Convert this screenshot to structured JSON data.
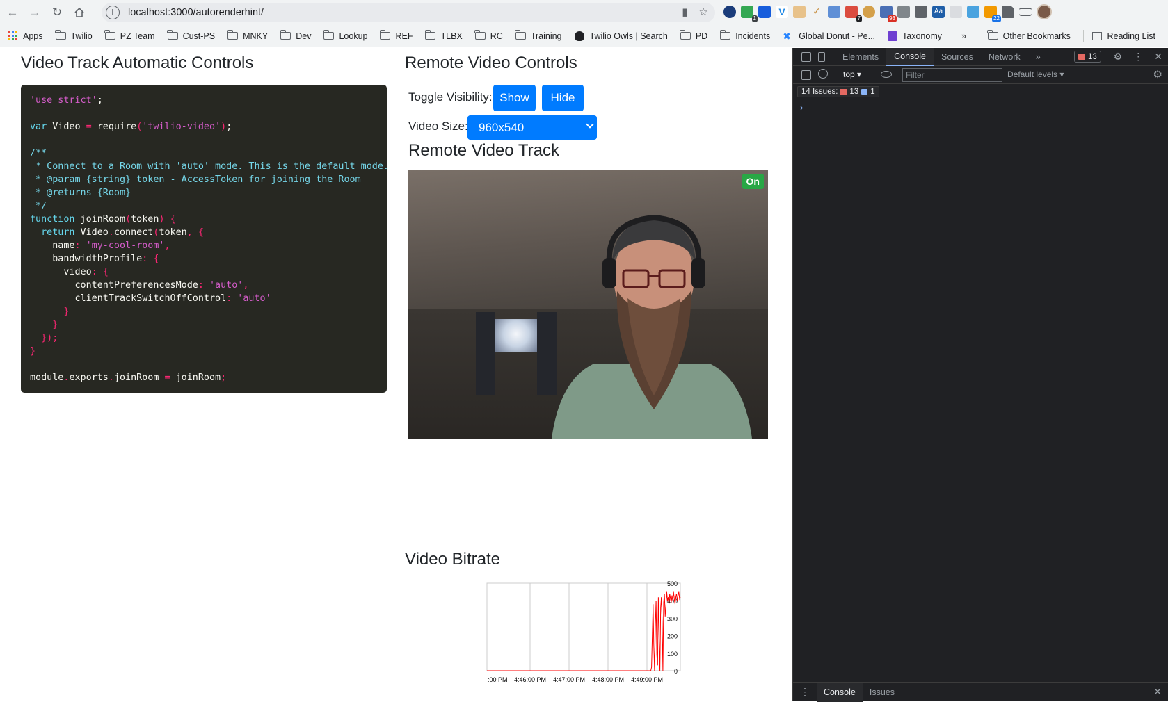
{
  "browser": {
    "url": "localhost:3000/autorenderhint/",
    "bookmarks": [
      {
        "label": "Apps",
        "type": "apps"
      },
      {
        "label": "Twilio",
        "type": "folder"
      },
      {
        "label": "PZ Team",
        "type": "folder"
      },
      {
        "label": "Cust-PS",
        "type": "folder"
      },
      {
        "label": "MNKY",
        "type": "folder"
      },
      {
        "label": "Dev",
        "type": "folder"
      },
      {
        "label": "Lookup",
        "type": "folder"
      },
      {
        "label": "REF",
        "type": "folder"
      },
      {
        "label": "TLBX",
        "type": "folder"
      },
      {
        "label": "RC",
        "type": "folder"
      },
      {
        "label": "Training",
        "type": "folder"
      },
      {
        "label": "Twilio Owls | Search",
        "type": "owl"
      },
      {
        "label": "PD",
        "type": "folder"
      },
      {
        "label": "Incidents",
        "type": "folder"
      },
      {
        "label": "Global Donut - Pe...",
        "type": "atlassian"
      },
      {
        "label": "Taxonomy",
        "type": "taxonomy"
      }
    ],
    "overflow": "»",
    "other_bookmarks": "Other Bookmarks",
    "reading_list": "Reading List",
    "ext_badges": {
      "b1": "1",
      "b7": "7",
      "b93": "93",
      "b22": "22"
    }
  },
  "left": {
    "title": "Video Track Automatic Controls",
    "code_lines": [
      [
        [
          "c-pink",
          "'use strict'"
        ],
        [
          "",
          "; "
        ]
      ],
      [],
      [
        [
          "c-kw",
          "var"
        ],
        [
          "",
          " Video "
        ],
        [
          "c-red",
          "="
        ],
        [
          "",
          " require"
        ],
        [
          "c-red",
          "("
        ],
        [
          "c-pink",
          "'twilio-video'"
        ],
        [
          "c-red",
          ")"
        ],
        [
          "",
          ";"
        ]
      ],
      [],
      [
        [
          "c-com",
          "/**"
        ]
      ],
      [
        [
          "c-com",
          " * Connect to a Room with 'auto' mode. This is the default mode."
        ]
      ],
      [
        [
          "c-com",
          " * @param {string} token - AccessToken for joining the Room"
        ]
      ],
      [
        [
          "c-com",
          " * @returns {Room}"
        ]
      ],
      [
        [
          "c-com",
          " */"
        ]
      ],
      [
        [
          "c-kw",
          "function"
        ],
        [
          "",
          " joinRoom"
        ],
        [
          "c-red",
          "("
        ],
        [
          "",
          "token"
        ],
        [
          "c-red",
          ")"
        ],
        [
          "",
          " "
        ],
        [
          "c-red",
          "{"
        ]
      ],
      [
        [
          "",
          "  "
        ],
        [
          "c-kw",
          "return"
        ],
        [
          "",
          " Video"
        ],
        [
          "c-red",
          "."
        ],
        [
          "",
          "connect"
        ],
        [
          "c-red",
          "("
        ],
        [
          "",
          "token"
        ],
        [
          "c-red",
          ","
        ],
        [
          "",
          " "
        ],
        [
          "c-red",
          "{"
        ]
      ],
      [
        [
          "",
          "    name"
        ],
        [
          "c-red",
          ":"
        ],
        [
          "",
          " "
        ],
        [
          "c-pink",
          "'my-cool-room'"
        ],
        [
          "c-red",
          ","
        ]
      ],
      [
        [
          "",
          "    bandwidthProfile"
        ],
        [
          "c-red",
          ":"
        ],
        [
          "",
          " "
        ],
        [
          "c-red",
          "{"
        ]
      ],
      [
        [
          "",
          "      video"
        ],
        [
          "c-red",
          ":"
        ],
        [
          "",
          " "
        ],
        [
          "c-red",
          "{"
        ]
      ],
      [
        [
          "",
          "        contentPreferencesMode"
        ],
        [
          "c-red",
          ":"
        ],
        [
          "",
          " "
        ],
        [
          "c-pink",
          "'auto'"
        ],
        [
          "c-red",
          ","
        ]
      ],
      [
        [
          "",
          "        clientTrackSwitchOffControl"
        ],
        [
          "c-red",
          ":"
        ],
        [
          "",
          " "
        ],
        [
          "c-pink",
          "'auto'"
        ]
      ],
      [
        [
          "",
          "      "
        ],
        [
          "c-red",
          "}"
        ]
      ],
      [
        [
          "",
          "    "
        ],
        [
          "c-red",
          "}"
        ]
      ],
      [
        [
          "",
          "  "
        ],
        [
          "c-red",
          "});"
        ]
      ],
      [
        [
          "c-red",
          "}"
        ]
      ],
      [],
      [
        [
          "",
          "module"
        ],
        [
          "c-red",
          "."
        ],
        [
          "",
          "exports"
        ],
        [
          "c-red",
          "."
        ],
        [
          "",
          "joinRoom "
        ],
        [
          "c-red",
          "="
        ],
        [
          "",
          " joinRoom"
        ],
        [
          "c-red",
          ";"
        ]
      ]
    ]
  },
  "right": {
    "title": "Remote Video Controls",
    "toggle_label": "Toggle Visibility:",
    "show_btn": "Show",
    "hide_btn": "Hide",
    "size_label": "Video Size:",
    "size_value": "960x540",
    "track_title": "Remote Video Track",
    "track_status": "On",
    "bitrate_title": "Video Bitrate"
  },
  "chart_data": {
    "type": "line",
    "title": "",
    "xlabel": "",
    "ylabel": "",
    "ylim": [
      0,
      500
    ],
    "y_ticks": [
      "500",
      "400",
      "300",
      "200",
      "100",
      "0"
    ],
    "x_ticks": [
      ":00 PM",
      "4:46:00 PM",
      "4:47:00 PM",
      "4:48:00 PM",
      "4:49:00 PM"
    ],
    "series_color": "#ff0000",
    "series": [
      {
        "values": [
          0,
          0,
          0,
          0,
          0,
          0,
          0,
          0,
          0,
          0,
          0,
          0,
          0,
          0,
          0,
          0,
          0,
          0,
          0,
          0,
          0,
          0,
          0,
          0,
          0,
          0,
          0,
          0,
          0,
          0,
          0,
          0,
          0,
          0,
          0,
          0,
          0,
          0,
          0,
          0,
          0,
          0,
          0,
          0,
          0,
          0,
          0,
          0,
          0,
          0,
          0,
          0,
          0,
          0,
          0,
          0,
          0,
          0,
          0,
          0,
          0,
          0,
          0,
          0,
          0,
          0,
          0,
          0,
          0,
          0,
          0,
          0,
          0,
          0,
          0,
          0,
          0,
          0,
          0,
          0,
          0,
          0,
          0,
          0,
          0,
          0,
          0,
          0,
          0,
          0,
          0,
          0,
          0,
          0,
          0,
          0,
          0,
          0,
          0,
          0,
          0,
          0,
          0,
          0,
          0,
          0,
          0,
          0,
          0,
          0,
          0,
          0,
          0,
          0,
          0,
          0,
          0,
          0,
          0,
          0,
          0,
          0,
          0,
          0,
          0,
          0,
          0,
          0,
          0,
          0,
          0,
          0,
          0,
          0,
          0,
          0,
          0,
          0,
          0,
          0,
          0,
          0,
          0,
          0,
          0,
          0,
          0,
          0,
          0,
          0,
          0,
          0,
          0,
          0,
          0,
          0,
          0,
          0,
          0,
          0,
          0,
          0,
          0,
          0,
          0,
          0,
          0,
          0,
          0,
          0,
          0,
          0,
          0,
          0,
          0,
          0,
          0,
          0,
          0,
          0,
          0,
          0,
          0,
          0,
          0,
          0,
          0,
          0,
          0,
          0,
          0,
          0,
          0,
          0,
          0,
          0,
          0,
          0,
          0,
          0,
          0,
          0,
          0,
          0,
          0,
          0,
          0,
          0,
          0,
          0,
          0,
          0,
          0,
          0,
          0,
          0,
          0,
          20,
          200,
          380,
          150,
          0,
          250,
          400,
          90,
          30,
          420,
          180,
          0,
          360,
          420,
          280,
          0,
          390,
          440,
          310,
          370,
          450,
          400,
          420,
          380,
          440,
          410,
          390,
          430,
          400,
          450,
          410,
          380,
          420,
          440,
          400,
          430,
          450,
          410,
          420
        ]
      }
    ]
  },
  "devtools": {
    "tabs": [
      "Elements",
      "Console",
      "Sources",
      "Network"
    ],
    "active_tab": "Console",
    "more": "»",
    "error_count": "13",
    "context": "top",
    "filter_placeholder": "Filter",
    "levels": "Default levels",
    "issues_label": "14 Issues:",
    "issues_errors": "13",
    "issues_info": "1",
    "prompt": "›",
    "bottom_tabs": [
      "Console",
      "Issues"
    ]
  }
}
